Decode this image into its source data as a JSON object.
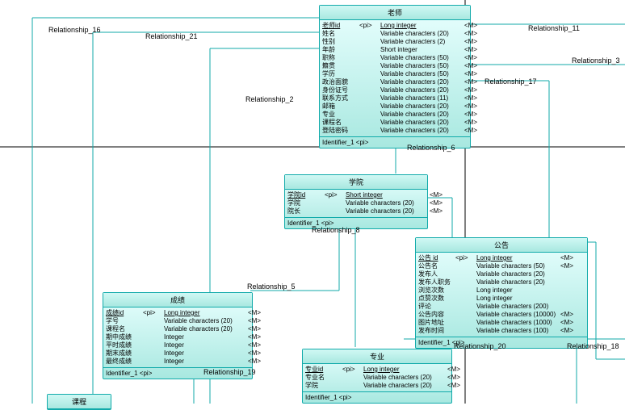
{
  "entities": {
    "teacher": {
      "title": "老师",
      "attrs": [
        {
          "name": "老师id",
          "pi": "<pi>",
          "type": "Long integer",
          "m": "<M>",
          "ul": true
        },
        {
          "name": "姓名",
          "pi": "",
          "type": "Variable characters (20)",
          "m": "<M>"
        },
        {
          "name": "性别",
          "pi": "",
          "type": "Variable characters (2)",
          "m": "<M>"
        },
        {
          "name": "年龄",
          "pi": "",
          "type": "Short integer",
          "m": "<M>"
        },
        {
          "name": "职称",
          "pi": "",
          "type": "Variable characters (50)",
          "m": "<M>"
        },
        {
          "name": "籍贯",
          "pi": "",
          "type": "Variable characters (50)",
          "m": "<M>"
        },
        {
          "name": "学历",
          "pi": "",
          "type": "Variable characters (50)",
          "m": "<M>"
        },
        {
          "name": "政治面貌",
          "pi": "",
          "type": "Variable characters (20)",
          "m": "<M>"
        },
        {
          "name": "身份证号",
          "pi": "",
          "type": "Variable characters (20)",
          "m": "<M>"
        },
        {
          "name": "联系方式",
          "pi": "",
          "type": "Variable characters (11)",
          "m": "<M>"
        },
        {
          "name": "邮箱",
          "pi": "",
          "type": "Variable characters (20)",
          "m": "<M>"
        },
        {
          "name": "专业",
          "pi": "",
          "type": "Variable characters (20)",
          "m": "<M>"
        },
        {
          "name": "课程名",
          "pi": "",
          "type": "Variable characters (20)",
          "m": "<M>"
        },
        {
          "name": "登陆密码",
          "pi": "",
          "type": "Variable characters (20)",
          "m": "<M>"
        }
      ],
      "footer": "Identifier_1 <pi>"
    },
    "college": {
      "title": "学院",
      "attrs": [
        {
          "name": "学院id",
          "pi": "<pi>",
          "type": "Short integer",
          "m": "<M>",
          "ul": true
        },
        {
          "name": "学院",
          "pi": "",
          "type": "Variable characters (20)",
          "m": "<M>"
        },
        {
          "name": "院长",
          "pi": "",
          "type": "Variable characters (20)",
          "m": "<M>"
        }
      ],
      "footer": "Identifier_1 <pi>"
    },
    "notice": {
      "title": "公告",
      "attrs": [
        {
          "name": "公告 id",
          "pi": "<pi>",
          "type": "Long integer",
          "m": "<M>",
          "ul": true
        },
        {
          "name": "公告名",
          "pi": "",
          "type": "Variable characters (50)",
          "m": "<M>"
        },
        {
          "name": "发布人",
          "pi": "",
          "type": "Variable characters (20)",
          "m": ""
        },
        {
          "name": "发布人职务",
          "pi": "",
          "type": "Variable characters (20)",
          "m": ""
        },
        {
          "name": "浏览次数",
          "pi": "",
          "type": "Long integer",
          "m": ""
        },
        {
          "name": "点赞次数",
          "pi": "",
          "type": "Long integer",
          "m": ""
        },
        {
          "name": "评论",
          "pi": "",
          "type": "Variable characters (200)",
          "m": ""
        },
        {
          "name": "公告内容",
          "pi": "",
          "type": "Variable characters (10000)",
          "m": "<M>"
        },
        {
          "name": "图片地址",
          "pi": "",
          "type": "Variable characters (1000)",
          "m": "<M>"
        },
        {
          "name": "发布时间",
          "pi": "",
          "type": "Variable characters (100)",
          "m": "<M>"
        }
      ],
      "footer": "Identifier_1 <pi>"
    },
    "grade": {
      "title": "成绩",
      "attrs": [
        {
          "name": "成绩id",
          "pi": "<pi>",
          "type": "Long integer",
          "m": "<M>",
          "ul": true
        },
        {
          "name": "学号",
          "pi": "",
          "type": "Variable characters (20)",
          "m": "<M>"
        },
        {
          "name": "课程名",
          "pi": "",
          "type": "Variable characters (20)",
          "m": "<M>"
        },
        {
          "name": "期中成绩",
          "pi": "",
          "type": "Integer",
          "m": "<M>"
        },
        {
          "name": "平时成绩",
          "pi": "",
          "type": "Integer",
          "m": "<M>"
        },
        {
          "name": "期末成绩",
          "pi": "",
          "type": "Integer",
          "m": "<M>"
        },
        {
          "name": "最终成绩",
          "pi": "",
          "type": "Integer",
          "m": "<M>"
        }
      ],
      "footer": "Identifier_1 <pi>"
    },
    "major": {
      "title": "专业",
      "attrs": [
        {
          "name": "专业id",
          "pi": "<pi>",
          "type": "Long integer",
          "m": "<M>",
          "ul": true
        },
        {
          "name": "专业名",
          "pi": "",
          "type": "Variable characters (20)",
          "m": "<M>"
        },
        {
          "name": "学院",
          "pi": "",
          "type": "Variable characters (20)",
          "m": "<M>"
        }
      ],
      "footer": "Identifier_1 <pi>"
    },
    "course": {
      "title": "课程"
    }
  },
  "relationships": {
    "r2": "Relationship_2",
    "r3": "Relationship_3",
    "r5": "Relationship_5",
    "r6": "Relationship_6",
    "r8": "Relationship_8",
    "r11": "Relationship_11",
    "r16": "Relationship_16",
    "r17": "Relationship_17",
    "r18": "Relationship_18",
    "r19": "Relationship_19",
    "r20": "Relationship_20",
    "r21": "Relationship_21"
  },
  "chart_data": {
    "type": "diagram",
    "diagram_type": "ER/CDM",
    "entities": [
      "老师",
      "学院",
      "公告",
      "成绩",
      "专业",
      "课程"
    ],
    "relationships": [
      "Relationship_2",
      "Relationship_3",
      "Relationship_5",
      "Relationship_6",
      "Relationship_8",
      "Relationship_11",
      "Relationship_16",
      "Relationship_17",
      "Relationship_18",
      "Relationship_19",
      "Relationship_20",
      "Relationship_21"
    ]
  }
}
